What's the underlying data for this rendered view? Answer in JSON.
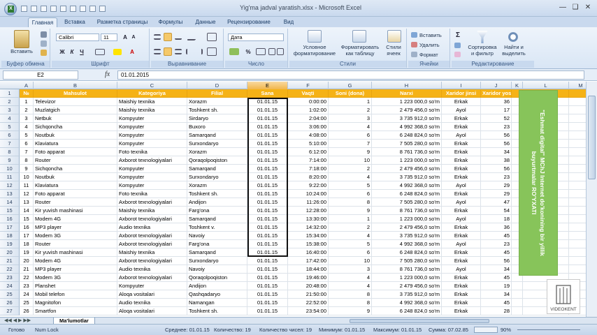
{
  "window": {
    "title": "Yig'ma jadval yaratish.xlsx - Microsoft Excel"
  },
  "tabs": [
    "Главная",
    "Вставка",
    "Разметка страницы",
    "Формулы",
    "Данные",
    "Рецензирование",
    "Вид"
  ],
  "ribbon": {
    "paste": "Вставить",
    "clipboard": "Буфер обмена",
    "font_name": "Calibri",
    "font_size": "11",
    "font_group": "Шрифт",
    "align_group": "Выравнивание",
    "number_format": "Дата",
    "number_group": "Число",
    "cond_format": "Условное\nформатирование",
    "format_table": "Форматировать\nкак таблицу",
    "cell_styles": "Стили\nячеек",
    "styles_group": "Стили",
    "insert": "Вставить",
    "delete": "Удалить",
    "format": "Формат",
    "cells_group": "Ячейки",
    "sort": "Сортировка\nи фильтр",
    "find": "Найти и\nвыделить",
    "edit_group": "Редактирование"
  },
  "formula_bar": {
    "name_box": "E2",
    "fx": "fx",
    "value": "01.01.2015"
  },
  "columns": [
    "A",
    "B",
    "C",
    "D",
    "E",
    "F",
    "G",
    "H",
    "I",
    "J",
    "K",
    "L",
    "M"
  ],
  "headers": [
    "№",
    "Mahsulot",
    "Kategoriya",
    "Filial",
    "Sana",
    "Vaqti",
    "Soni (dona)",
    "Narxi",
    "Xaridor jinsi",
    "Xaridor yoshi"
  ],
  "rows": [
    [
      "1",
      "Televizor",
      "Maishiy texnika",
      "Xorazm",
      "01.01.15",
      "0:00:00",
      "1",
      "1 223 000,0 so'm",
      "Erkak",
      "36"
    ],
    [
      "2",
      "Muzlatgich",
      "Maishiy texnika",
      "Toshkent sh.",
      "01.01.15",
      "1:02:00",
      "2",
      "2 479 456,0 so'm",
      "Ayol",
      "17"
    ],
    [
      "3",
      "Netbuk",
      "Kompyuter",
      "Sirdaryo",
      "01.01.15",
      "2:04:00",
      "3",
      "3 735 912,0 so'm",
      "Erkak",
      "52"
    ],
    [
      "4",
      "Sichqoncha",
      "Kompyuter",
      "Buxoro",
      "01.01.15",
      "3:06:00",
      "4",
      "4 992 368,0 so'm",
      "Erkak",
      "23"
    ],
    [
      "5",
      "Noutbuk",
      "Kompyuter",
      "Samarqand",
      "01.01.15",
      "4:08:00",
      "6",
      "6 248 824,0 so'm",
      "Ayol",
      "56"
    ],
    [
      "6",
      "Klaviatura",
      "Kompyuter",
      "Surxondaryo",
      "01.01.15",
      "5:10:00",
      "7",
      "7 505 280,0 so'm",
      "Erkak",
      "56"
    ],
    [
      "7",
      "Foto apparat",
      "Foto texnika",
      "Xorazm",
      "01.01.15",
      "6:12:00",
      "9",
      "8 761 736,0 so'm",
      "Erkak",
      "34"
    ],
    [
      "8",
      "Router",
      "Axborot texnologiyalari",
      "Qoraqolpoqiston",
      "01.01.15",
      "7:14:00",
      "10",
      "1 223 000,0 so'm",
      "Erkak",
      "38"
    ],
    [
      "9",
      "Sichqoncha",
      "Kompyuter",
      "Samarqand",
      "01.01.15",
      "7:18:00",
      "2",
      "2 479 456,0 so'm",
      "Erkak",
      "56"
    ],
    [
      "10",
      "Noutbuk",
      "Kompyuter",
      "Surxondaryo",
      "01.01.15",
      "8:20:00",
      "4",
      "3 735 912,0 so'm",
      "Erkak",
      "23"
    ],
    [
      "11",
      "Klaviatura",
      "Kompyuter",
      "Xorazm",
      "01.01.15",
      "9:22:00",
      "5",
      "4 992 368,0 so'm",
      "Ayol",
      "29"
    ],
    [
      "12",
      "Foto apparat",
      "Foto texnika",
      "Toshkent sh.",
      "01.01.15",
      "10:24:00",
      "6",
      "6 248 824,0 so'm",
      "Erkak",
      "29"
    ],
    [
      "13",
      "Router",
      "Axborot texnologiyalari",
      "Andijon",
      "01.01.15",
      "11:26:00",
      "8",
      "7 505 280,0 so'm",
      "Ayol",
      "47"
    ],
    [
      "14",
      "Kir yuvish mashinasi",
      "Maishiy texnika",
      "Farg'ona",
      "01.01.15",
      "12:28:00",
      "9",
      "8 761 736,0 so'm",
      "Erkak",
      "54"
    ],
    [
      "15",
      "Modem 4G",
      "Axborot texnologiyalari",
      "Samarqand",
      "01.01.15",
      "13:30:00",
      "1",
      "1 223 000,0 so'm",
      "Ayol",
      "18"
    ],
    [
      "16",
      "MP3 player",
      "Audio texnika",
      "Toshkent v.",
      "01.01.15",
      "14:32:00",
      "2",
      "2 479 456,0 so'm",
      "Erkak",
      "36"
    ],
    [
      "17",
      "Modem 3G",
      "Axborot texnologiyalari",
      "Navoiy",
      "01.01.15",
      "15:34:00",
      "4",
      "3 735 912,0 so'm",
      "Erkak",
      "45"
    ],
    [
      "18",
      "Router",
      "Axborot texnologiyalari",
      "Farg'ona",
      "01.01.15",
      "15:38:00",
      "5",
      "4 992 368,0 so'm",
      "Ayol",
      "23"
    ],
    [
      "19",
      "Kir yuvish mashinasi",
      "Maishiy texnika",
      "Samarqand",
      "01.01.15",
      "16:40:00",
      "6",
      "6 248 824,0 so'm",
      "Erkak",
      "45"
    ],
    [
      "20",
      "Modem 4G",
      "Axborot texnologiyalari",
      "Surxondaryo",
      "01.01.15",
      "17:42:00",
      "10",
      "7 505 280,0 so'm",
      "Erkak",
      "56"
    ],
    [
      "21",
      "MP3 player",
      "Audio texnika",
      "Navoiy",
      "01.01.15",
      "18:44:00",
      "3",
      "8 761 736,0 so'm",
      "Ayol",
      "34"
    ],
    [
      "22",
      "Modem 3G",
      "Axborot texnologiyalari",
      "Qoraqolpoqiston",
      "01.01.15",
      "19:46:00",
      "4",
      "1 223 000,0 so'm",
      "Erkak",
      "45"
    ],
    [
      "23",
      "Planshet",
      "Kompyuter",
      "Andijon",
      "01.01.15",
      "20:48:00",
      "4",
      "2 479 456,0 so'm",
      "Erkak",
      "19"
    ],
    [
      "24",
      "Mobil telefon",
      "Aloqa vositalari",
      "Qashqadaryo",
      "01.01.15",
      "21:50:00",
      "8",
      "3 735 912,0 so'm",
      "Erkak",
      "34"
    ],
    [
      "25",
      "Magnitofon",
      "Audio texnika",
      "Namangan",
      "01.01.15",
      "22:52:00",
      "8",
      "4 992 368,0 so'm",
      "Erkak",
      "45"
    ],
    [
      "26",
      "Smartfon",
      "Aloqa vositalari",
      "Toshkent sh.",
      "01.01.15",
      "23:54:00",
      "9",
      "6 248 824,0 so'm",
      "Erkak",
      "28"
    ]
  ],
  "side_note": "\"Eshmat digital\" MChJ Internet do'konining bir yillik buyurtmalar RO'YXATI",
  "logo": "VIDEOKENT",
  "sheet_tab": "Ma'lumotlar",
  "status": {
    "ready": "Готово",
    "numlock": "Num Lock",
    "average": "Среднее: 01.01.15",
    "count": "Количество: 19",
    "numcount": "Количество чисел: 19",
    "min": "Минимум: 01.01.15",
    "max": "Максимум: 01.01.15",
    "sum": "Сумма: 07.02.85",
    "zoom": "90%"
  }
}
